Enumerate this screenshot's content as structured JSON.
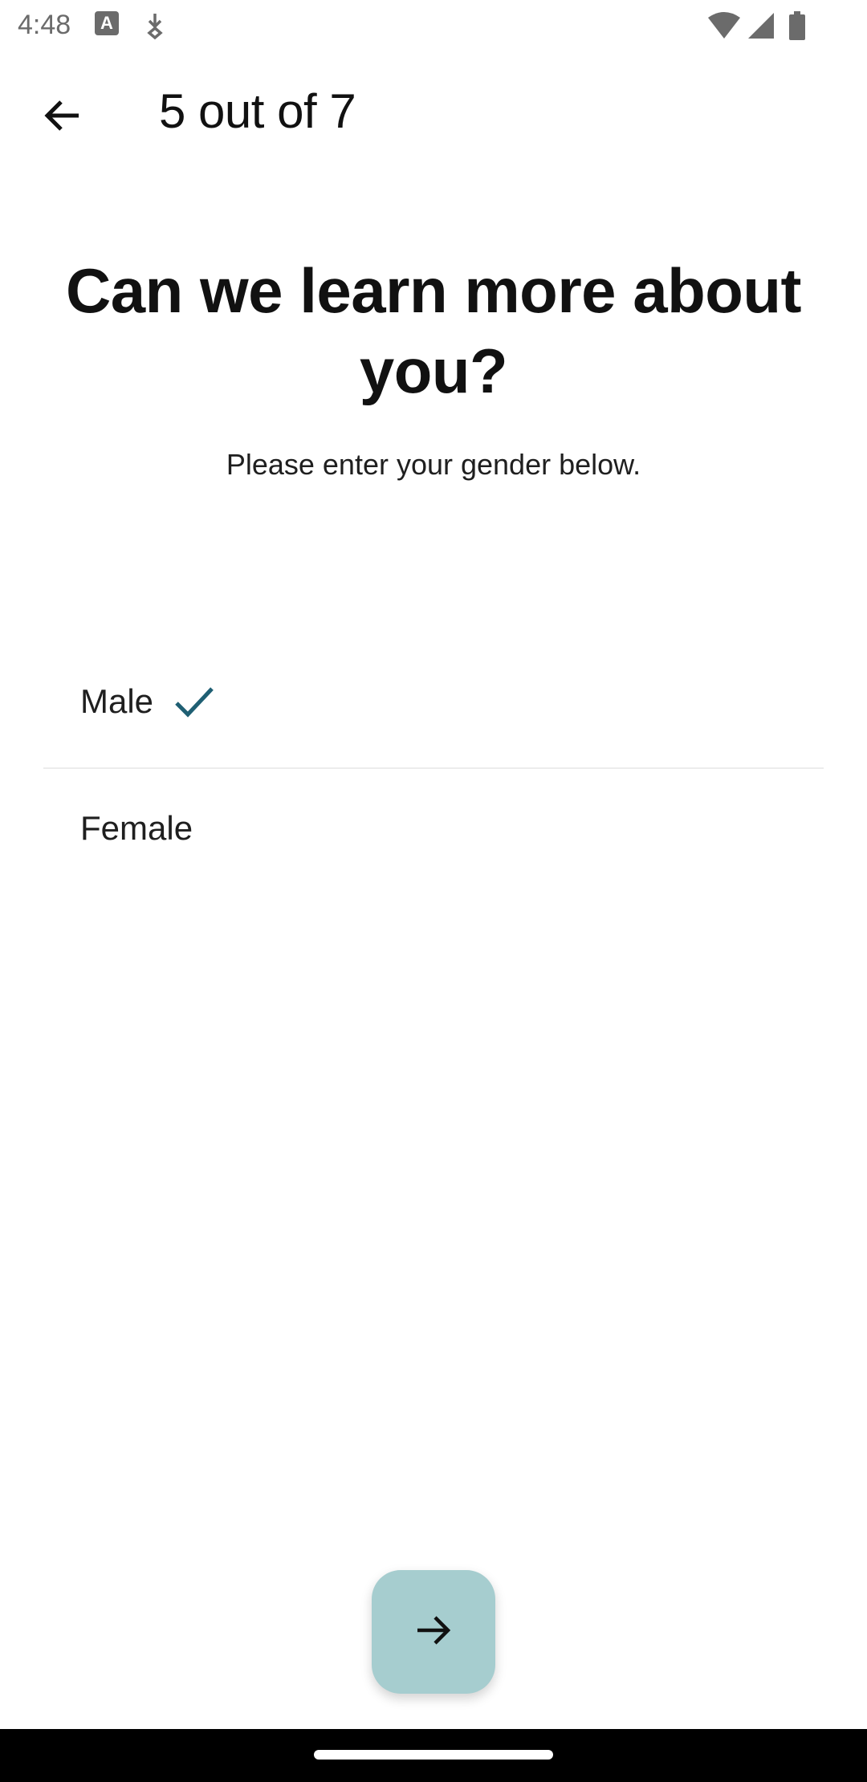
{
  "status_bar": {
    "time": "4:48",
    "keyboard_badge": "A",
    "icons": [
      "keyboard-a-icon",
      "download-icon",
      "wifi-icon",
      "signal-icon",
      "battery-icon"
    ]
  },
  "app_bar": {
    "back_icon": "arrow-left-icon",
    "title": "5 out of 7"
  },
  "content": {
    "headline": "Can we learn more about you?",
    "subtitle": "Please enter your gender below."
  },
  "options": [
    {
      "label": "Male",
      "selected": true
    },
    {
      "label": "Female",
      "selected": false
    }
  ],
  "next_button": {
    "icon": "arrow-right-icon",
    "color": "#a6cdcf"
  },
  "colors": {
    "check": "#1f5f73",
    "fab": "#a6cdcf",
    "text": "#111111",
    "divider": "#ececec",
    "nav_bar": "#000000"
  }
}
